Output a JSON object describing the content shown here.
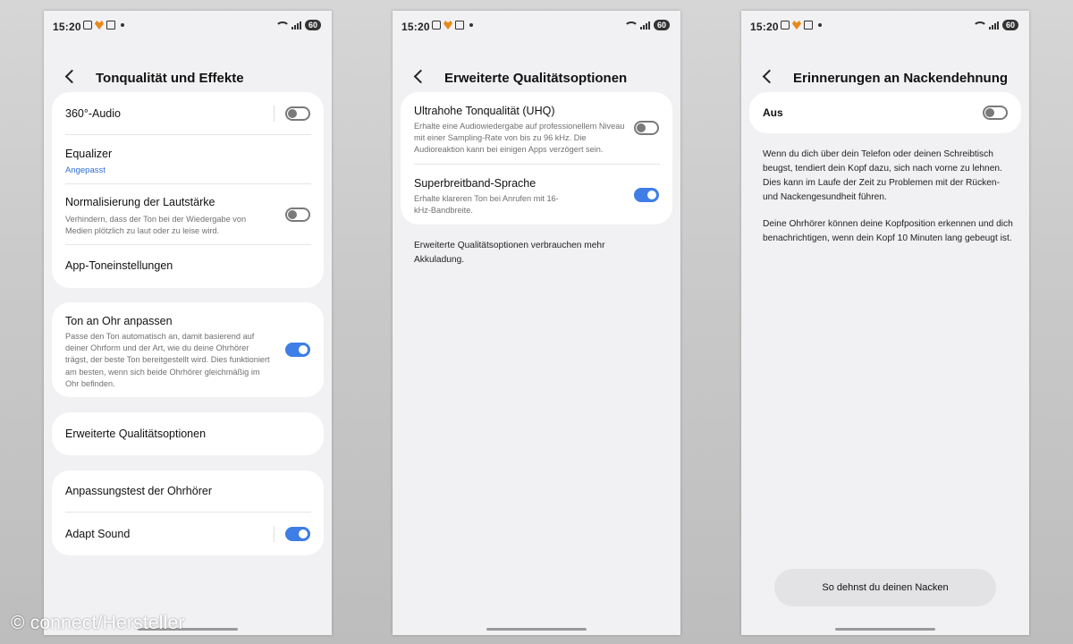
{
  "statusbar": {
    "time": "15:20",
    "battery": "60"
  },
  "screen1": {
    "title": "Tonqualität und Effekte",
    "card1": {
      "audio360": {
        "label": "360°-Audio",
        "toggle": "off"
      },
      "equalizer": {
        "label": "Equalizer",
        "value": "Angepasst"
      },
      "normalize": {
        "label": "Normalisierung der Lautstärke",
        "desc": "Verhindern, dass der Ton bei der Wiedergabe von Medien plötzlich zu laut oder zu leise wird.",
        "toggle": "off"
      },
      "app_sound": {
        "label": "App-Toneinstellungen"
      }
    },
    "card2": {
      "label": "Ton an Ohr anpassen",
      "desc": "Passe den Ton automatisch an, damit basierend auf deiner Ohrform und der Art, wie du deine Ohrhörer trägst, der beste Ton bereitgestellt wird. Dies funktioniert am besten, wenn sich beide Ohrhörer gleichmäßig im Ohr befinden.",
      "toggle": "on"
    },
    "card3": {
      "label": "Erweiterte Qualitätsoptionen"
    },
    "card4": {
      "fit_test": {
        "label": "Anpassungstest der Ohrhörer"
      },
      "adapt_sound": {
        "label": "Adapt Sound",
        "toggle": "on"
      }
    }
  },
  "screen2": {
    "title": "Erweiterte Qualitätsoptionen",
    "uhq": {
      "label": "Ultrahohe Tonqualität (UHQ)",
      "desc": "Erhalte eine Audiowiedergabe auf professionellem Niveau mit einer Sampling-Rate von bis zu 96 kHz. Die Audioreaktion kann bei einigen Apps verzögert sein.",
      "toggle": "off"
    },
    "swb": {
      "label": "Superbreitband-Sprache",
      "desc": "Erhalte klareren Ton bei Anrufen mit 16-kHz-Bandbreite.",
      "toggle": "on"
    },
    "note": "Erweiterte Qualitätsoptionen verbrauchen mehr Akkuladung."
  },
  "screen3": {
    "title": "Erinnerungen an Nackendehnung",
    "master": {
      "label": "Aus",
      "toggle": "off"
    },
    "para1": "Wenn du dich über dein Telefon oder deinen Schreibtisch beugst, tendiert dein Kopf dazu, sich nach vorne zu lehnen. Dies kann im Laufe der Zeit zu Problemen mit der Rücken- und Nackengesundheit führen.",
    "para2": "Deine Ohrhörer können deine Kopfposition erkennen und dich benachrichtigen, wenn dein Kopf 10 Minuten lang gebeugt ist.",
    "button": "So dehnst du deinen Nacken"
  },
  "watermark": "© connect/Hersteller",
  "colors": {
    "accent": "#3e7ee6",
    "link": "#2f6fd6",
    "screen_bg": "#f1f1f3",
    "card_bg": "#ffffff"
  }
}
